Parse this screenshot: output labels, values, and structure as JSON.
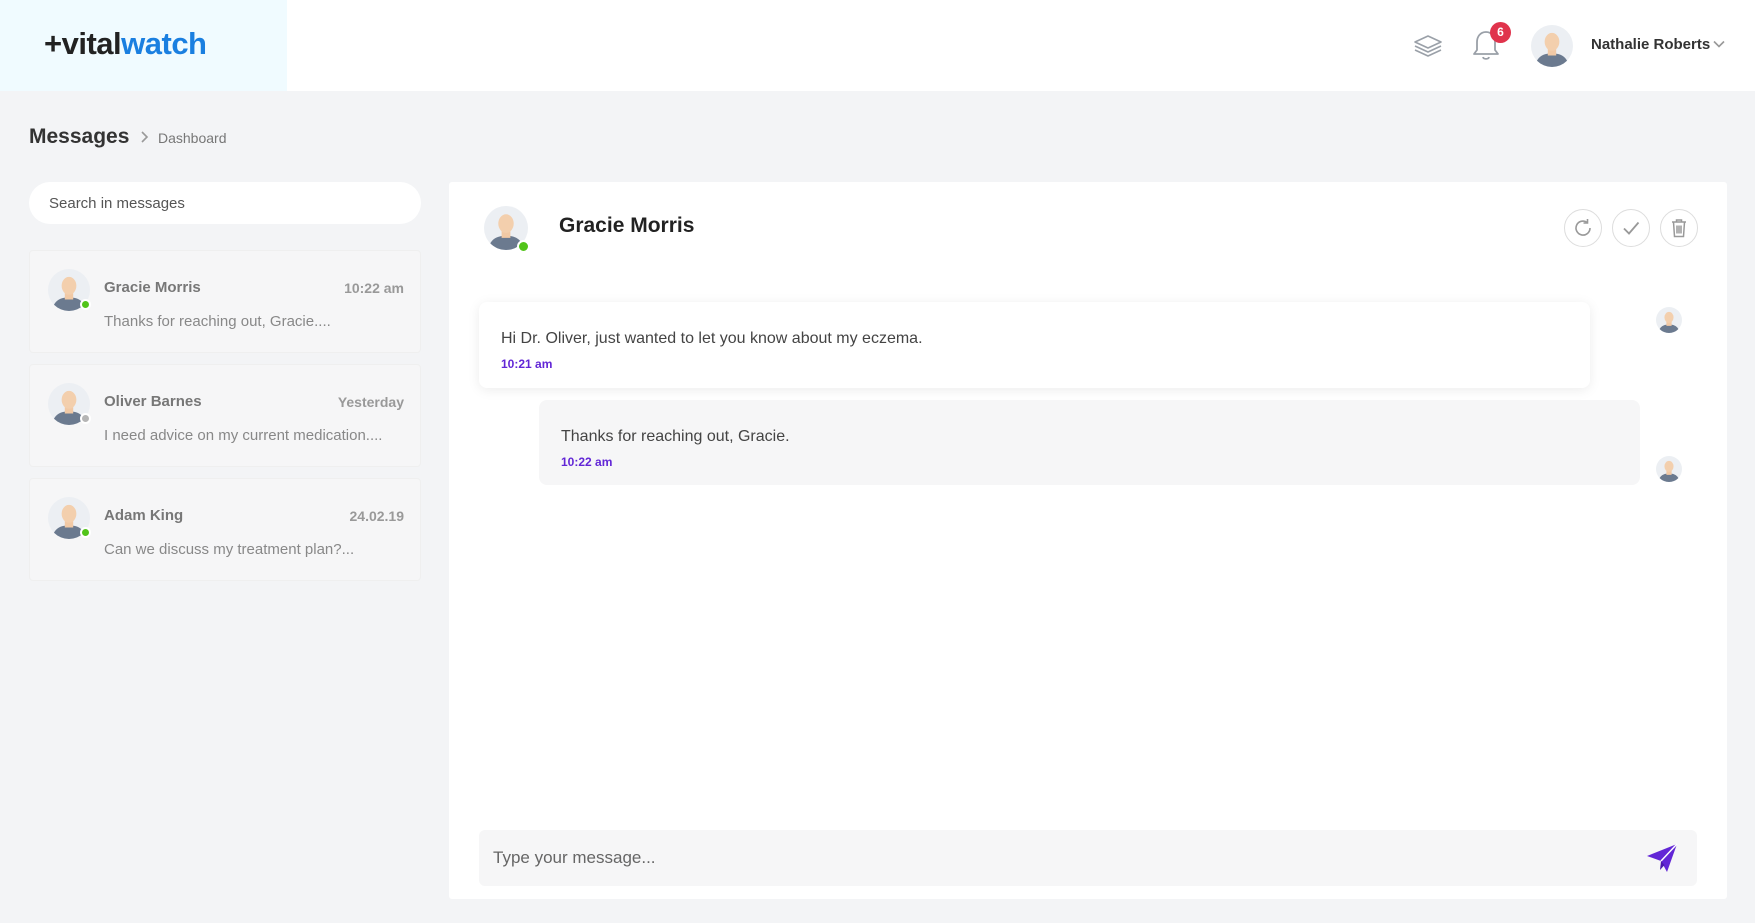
{
  "brand": {
    "plus": "+",
    "part1": "vital",
    "part2": "watch",
    "accent": "#1a7fe0"
  },
  "header": {
    "icons": [
      "layers-icon",
      "bell-icon"
    ],
    "notification_count": "6",
    "user_name": "Nathalie Roberts"
  },
  "breadcrumb": {
    "title": "Messages",
    "separator_icon": "chevron-right-icon",
    "current": "Dashboard"
  },
  "search": {
    "placeholder": "Search in messages"
  },
  "conversations": [
    {
      "name": "Gracie Morris",
      "time": "10:22 am",
      "preview": "Thanks for reaching out, Gracie....",
      "status": "online"
    },
    {
      "name": "Oliver Barnes",
      "time": "Yesterday",
      "preview": "I need advice on my current medication....",
      "status": "offline"
    },
    {
      "name": "Adam King",
      "time": "24.02.19",
      "preview": "Can we discuss my treatment plan?...",
      "status": "online"
    }
  ],
  "chat": {
    "contact_name": "Gracie Morris",
    "actions": [
      "refresh-icon",
      "check-icon",
      "trash-icon"
    ],
    "messages": [
      {
        "direction": "incoming",
        "text": "Hi Dr. Oliver, just wanted to let you know about my eczema.",
        "time": "10:21 am"
      },
      {
        "direction": "outgoing",
        "text": "Thanks for reaching out, Gracie.",
        "time": "10:22 am"
      }
    ],
    "composer": {
      "placeholder": "Type your message...",
      "send_icon": "send-icon"
    }
  },
  "colors": {
    "online": "#52c41a",
    "offline": "#b5b5b5",
    "time_accent": "#6226d6",
    "badge": "#e0334c"
  }
}
